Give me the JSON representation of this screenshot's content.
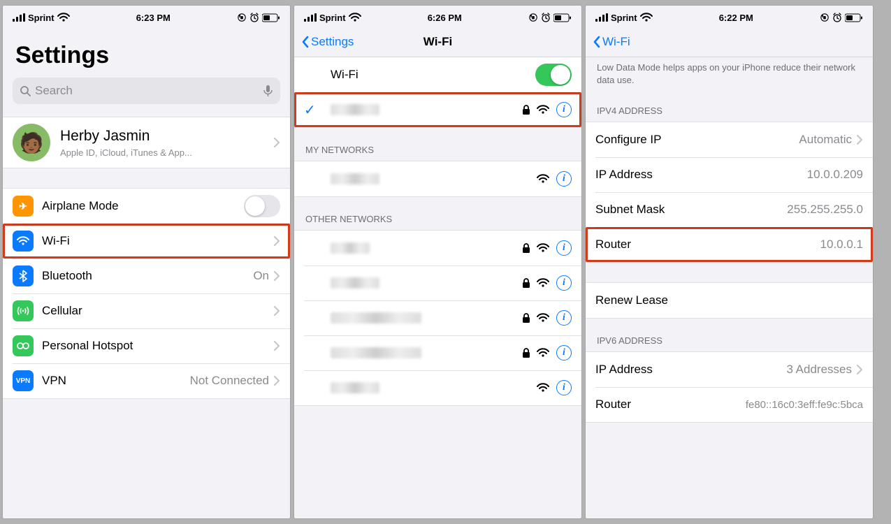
{
  "status": {
    "carrier": "Sprint",
    "times": {
      "screen1": "6:23 PM",
      "screen2": "6:26 PM",
      "screen3": "6:22 PM"
    }
  },
  "screen1": {
    "title": "Settings",
    "search_placeholder": "Search",
    "account": {
      "name": "Herby Jasmin",
      "sub": "Apple ID, iCloud, iTunes & App..."
    },
    "items": {
      "airplane": "Airplane Mode",
      "wifi": "Wi-Fi",
      "bluetooth": "Bluetooth",
      "bluetooth_value": "On",
      "cellular": "Cellular",
      "hotspot": "Personal Hotspot",
      "vpn": "VPN",
      "vpn_value": "Not Connected",
      "vpn_icon": "VPN"
    }
  },
  "screen2": {
    "back": "Settings",
    "title": "Wi-Fi",
    "toggle_label": "Wi-Fi",
    "header_my": "MY NETWORKS",
    "header_other": "OTHER NETWORKS"
  },
  "screen3": {
    "back": "Wi-Fi",
    "note": "Low Data Mode helps apps on your iPhone reduce their network data use.",
    "header_ipv4": "IPV4 ADDRESS",
    "rows": {
      "configure_ip": "Configure IP",
      "configure_ip_value": "Automatic",
      "ip_address": "IP Address",
      "ip_address_value": "10.0.0.209",
      "subnet": "Subnet Mask",
      "subnet_value": "255.255.255.0",
      "router": "Router",
      "router_value": "10.0.0.1"
    },
    "renew": "Renew Lease",
    "header_ipv6": "IPV6 ADDRESS",
    "ipv6": {
      "ip_address": "IP Address",
      "ip_address_value": "3 Addresses",
      "router": "Router",
      "router_value": "fe80::16c0:3eff:fe9c:5bca"
    }
  }
}
